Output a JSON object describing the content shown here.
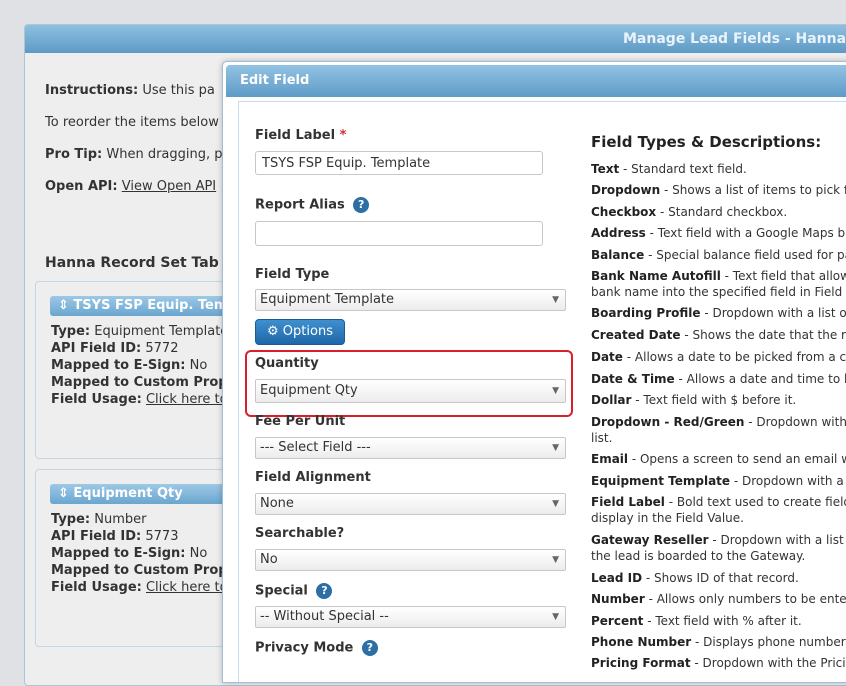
{
  "background": {
    "title": "Manage Lead Fields - Hanna",
    "instructions_label": "Instructions:",
    "instructions_text": "Use this pa",
    "reorder_text": "To reorder the items below",
    "protip_label": "Pro Tip:",
    "protip_text": "When dragging, p",
    "openapi_label": "Open API:",
    "openapi_link": "View Open API",
    "section_title": "Hanna Record Set Tab",
    "cards": [
      {
        "title": "⇕ TSYS FSP Equip. Tem",
        "type_label": "Type:",
        "type_value": "Equipment Template",
        "api_label": "API Field ID:",
        "api_value": "5772",
        "esign_label": "Mapped to E-Sign:",
        "esign_value": "No",
        "custom_label": "Mapped to Custom Proper",
        "usage_label": "Field Usage:",
        "usage_link": "Click here to s"
      },
      {
        "title": "⇕ Equipment Qty",
        "type_label": "Type:",
        "type_value": "Number",
        "api_label": "API Field ID:",
        "api_value": "5773",
        "esign_label": "Mapped to E-Sign:",
        "esign_value": "No",
        "custom_label": "Mapped to Custom Proper",
        "usage_label": "Field Usage:",
        "usage_link": "Click here to s"
      }
    ]
  },
  "dialog": {
    "title": "Edit Field",
    "field_label": {
      "label": "Field Label",
      "required": "*",
      "value": "TSYS FSP Equip. Template"
    },
    "report_alias": {
      "label": "Report Alias",
      "value": "",
      "help": "?"
    },
    "field_type": {
      "label": "Field Type",
      "selected": "Equipment Template"
    },
    "options_button": "⚙ Options",
    "quantity": {
      "label": "Quantity",
      "selected": "Equipment Qty"
    },
    "fee_per_unit": {
      "label": "Fee Per Unit",
      "selected": "--- Select Field ---"
    },
    "field_alignment": {
      "label": "Field Alignment",
      "selected": "None"
    },
    "searchable": {
      "label": "Searchable?",
      "selected": "No"
    },
    "special": {
      "label": "Special",
      "selected": "-- Without Special --",
      "help": "?"
    },
    "privacy_mode": {
      "label": "Privacy Mode",
      "help": "?"
    },
    "caret": "▼"
  },
  "field_types": {
    "title": "Field Types & Descriptions:",
    "items": [
      {
        "name": "Text",
        "desc": " - Standard text field."
      },
      {
        "name": "Dropdown",
        "desc": " - Shows a list of items to pick fron"
      },
      {
        "name": "Checkbox",
        "desc": " - Standard checkbox."
      },
      {
        "name": "Address",
        "desc": " - Text field with a Google Maps butto"
      },
      {
        "name": "Balance",
        "desc": " - Special balance field used for paym"
      },
      {
        "name": "Bank Name Autofill",
        "desc": " - Text field that allows to",
        "line2": "bank name into the specified field in Field Valu"
      },
      {
        "name": "Boarding Profile",
        "desc": " - Dropdown with a list of Tu"
      },
      {
        "name": "Created Date",
        "desc": " - Shows the date that the reco"
      },
      {
        "name": "Date",
        "desc": " - Allows a date to be picked from a caler"
      },
      {
        "name": "Date & Time",
        "desc": " - Allows a date and time to be p"
      },
      {
        "name": "Dollar",
        "desc": " - Text field with $ before it."
      },
      {
        "name": "Dropdown - Red/Green",
        "desc": " - Dropdown with a c",
        "line2": "list."
      },
      {
        "name": "Email",
        "desc": " - Opens a screen to send an email wher"
      },
      {
        "name": "Equipment Template",
        "desc": " - Dropdown with a list"
      },
      {
        "name": "Field Label",
        "desc": " - Bold text used to create field se",
        "line2": "display in the Field Value."
      },
      {
        "name": "Gateway Reseller",
        "desc": " - Dropdown with a list of G",
        "line2": "the lead is boarded to the Gateway."
      },
      {
        "name": "Lead ID",
        "desc": " - Shows ID of that record."
      },
      {
        "name": "Number",
        "desc": " - Allows only numbers to be entered"
      },
      {
        "name": "Percent",
        "desc": " - Text field with % after it."
      },
      {
        "name": "Phone Number",
        "desc": " - Displays phone number in t"
      },
      {
        "name": "Pricing Format",
        "desc": " - Dropdown with the Pricing F"
      }
    ]
  }
}
